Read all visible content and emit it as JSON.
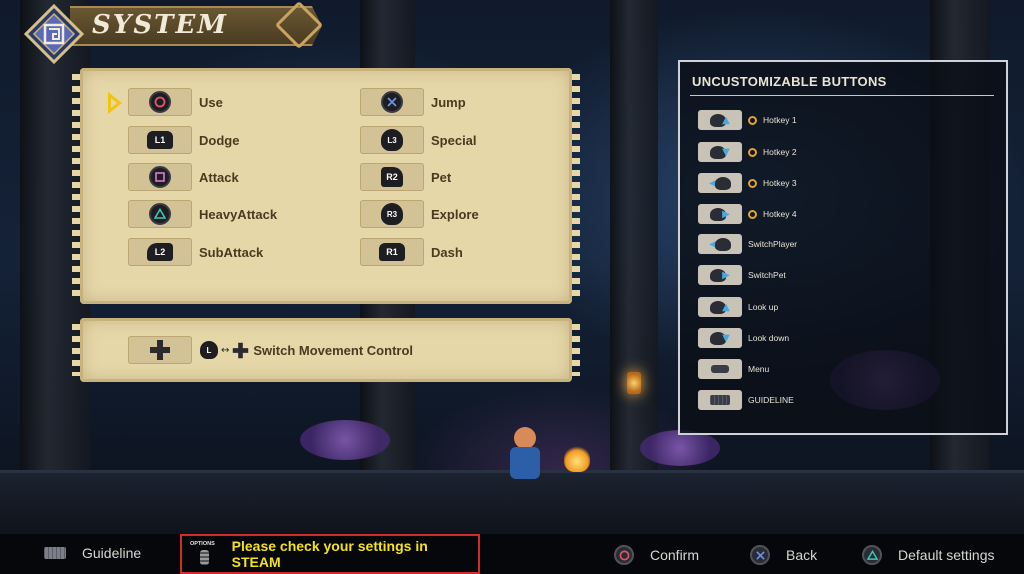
{
  "title": "SYSTEM",
  "cursor_on": "Use",
  "key_bindings": [
    {
      "label": "Use",
      "button": "circle",
      "icon": "circle-button-icon"
    },
    {
      "label": "Dodge",
      "button": "L1",
      "icon": "l1-button-icon"
    },
    {
      "label": "Attack",
      "button": "square",
      "icon": "square-button-icon"
    },
    {
      "label": "HeavyAttack",
      "button": "triangle",
      "icon": "triangle-button-icon"
    },
    {
      "label": "SubAttack",
      "button": "L2",
      "icon": "l2-button-icon"
    },
    {
      "label": "Jump",
      "button": "cross",
      "icon": "cross-button-icon"
    },
    {
      "label": "Special",
      "button": "L3",
      "icon": "l3-stick-icon"
    },
    {
      "label": "Pet",
      "button": "R2",
      "icon": "r2-button-icon"
    },
    {
      "label": "Explore",
      "button": "R3",
      "icon": "r3-stick-icon"
    },
    {
      "label": "Dash",
      "button": "R1",
      "icon": "r1-button-icon"
    }
  ],
  "move_control": {
    "label": "Switch Movement Control",
    "stick_label": "L",
    "icons": [
      "dpad-icon",
      "left-stick-icon",
      "swap-arrows-icon",
      "dpad-icon"
    ]
  },
  "uncustomizable": {
    "title": "UNCUSTOMIZABLE BUTTONS",
    "items": [
      {
        "label": "Hotkey 1",
        "hotkey": true,
        "icon": "right-stick-up-icon"
      },
      {
        "label": "Hotkey 2",
        "hotkey": true,
        "icon": "right-stick-down-icon"
      },
      {
        "label": "Hotkey 3",
        "hotkey": true,
        "icon": "right-stick-left-icon"
      },
      {
        "label": "Hotkey 4",
        "hotkey": true,
        "icon": "right-stick-right-icon"
      },
      {
        "label": "SwitchPlayer",
        "hotkey": false,
        "icon": "left-stick-left-icon"
      },
      {
        "label": "SwitchPet",
        "hotkey": false,
        "icon": "left-stick-right-icon"
      },
      {
        "label": "Look up",
        "hotkey": false,
        "icon": "left-stick-up-icon"
      },
      {
        "label": "Look down",
        "hotkey": false,
        "icon": "left-stick-down-icon"
      },
      {
        "label": "Menu",
        "hotkey": false,
        "icon": "options-button-icon"
      },
      {
        "label": "GUIDELINE",
        "hotkey": false,
        "icon": "touchpad-icon"
      }
    ]
  },
  "footer": {
    "guideline": "Guideline",
    "options_label": "OPTIONS",
    "steam_notice": "Please check your settings in STEAM",
    "confirm": "Confirm",
    "back": "Back",
    "default": "Default settings"
  },
  "colors": {
    "parchment": "#e6d7a9",
    "cursor": "#f1c40f",
    "notice_text": "#f4e21c",
    "notice_border": "#d32a2a",
    "circle": "#e0566b",
    "cross": "#6f8fe0",
    "square": "#d57dd0",
    "triangle": "#3fc7b4"
  }
}
